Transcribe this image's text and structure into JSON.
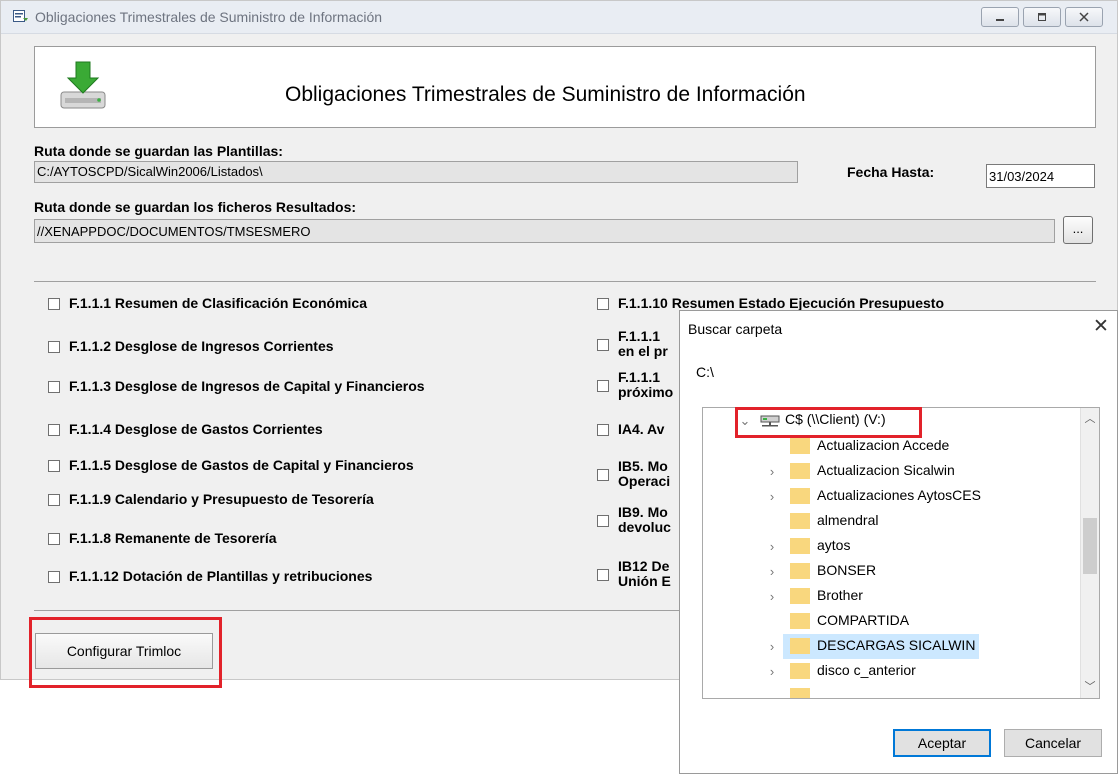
{
  "window": {
    "title": "Obligaciones Trimestrales de Suministro de Información",
    "controls": [
      "minimize-icon",
      "maximize-icon",
      "close-icon"
    ]
  },
  "header": {
    "title": "Obligaciones Trimestrales de Suministro de Información",
    "icon": "download-drive-icon"
  },
  "templates": {
    "label": "Ruta donde se guardan las Plantillas:",
    "value": "C:/AYTOSCPD/SicalWin2006/Listados\\"
  },
  "fecha": {
    "label": "Fecha Hasta:",
    "value": "31/03/2024"
  },
  "results": {
    "label": "Ruta donde se guardan los ficheros Resultados:",
    "value": "//XENAPPDOC/DOCUMENTOS/TMSESMERO",
    "browse_label": "..."
  },
  "checks_left": [
    "F.1.1.1 Resumen de Clasificación Económica",
    "F.1.1.2 Desglose de Ingresos Corrientes",
    "F.1.1.3 Desglose de Ingresos de Capital y Financieros",
    "F.1.1.4 Desglose de Gastos Corrientes",
    "F.1.1.5 Desglose de Gastos de Capital y Financieros",
    "F.1.1.9 Calendario y Presupuesto de Tesorería",
    "F.1.1.8 Remanente de Tesorería",
    "F.1.1.12 Dotación de Plantillas y retribuciones"
  ],
  "checks_right": [
    "F.1.1.10 Resumen Estado Ejecución Presupuesto",
    "F.1.1.1\nen el pr",
    "F.1.1.1\npróximo",
    "IA4. Av",
    "IB5. Mo\nOperaci",
    "IB9. Mo\ndevoluc",
    "IB12 De\nUnión E"
  ],
  "tab_button": "Configurar Trimloc",
  "dialog": {
    "title": "Buscar carpeta",
    "path": "C:\\",
    "root": "C$ (\\\\Client) (V:)",
    "folders": [
      "Actualizacion Accede",
      "Actualizacion Sicalwin",
      "Actualizaciones AytosCES",
      "almendral",
      "aytos",
      "BONSER",
      "Brother",
      "COMPARTIDA",
      "DESCARGAS SICALWIN",
      "disco c_anterior"
    ],
    "ok_label": "Aceptar",
    "cancel_label": "Cancelar"
  },
  "colors": {
    "highlight_red": "#e2222a",
    "selection_blue": "#cce8ff",
    "primary_border": "#0078d7"
  }
}
